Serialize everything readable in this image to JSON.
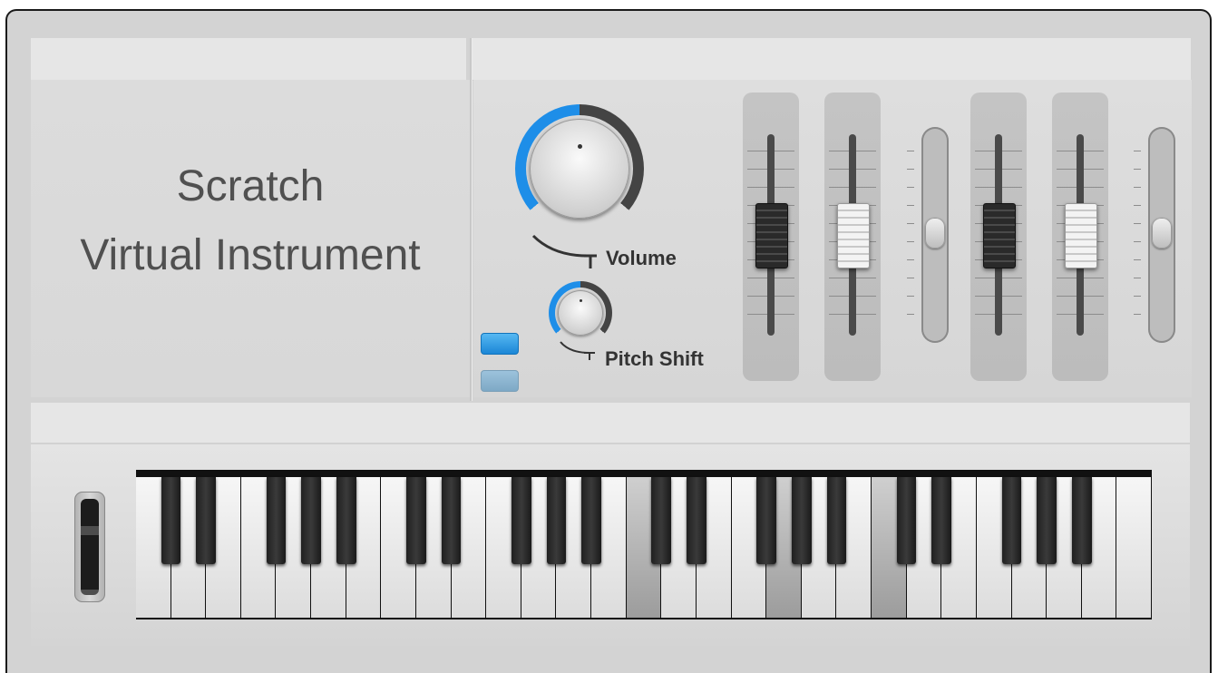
{
  "header": {
    "title_line1": "Scratch",
    "title_line2": "Virtual Instrument"
  },
  "controls": {
    "volume_label": "Volume",
    "pitch_shift_label": "Pitch Shift",
    "volume_level": 0.62,
    "pitch_shift_level": 0.5,
    "buttons": [
      {
        "name": "add-button",
        "state": "active"
      },
      {
        "name": "add-button-secondary",
        "state": "inactive"
      }
    ]
  },
  "faders": [
    {
      "style": "dark",
      "level": 0.5
    },
    {
      "style": "light",
      "level": 0.5
    },
    {
      "style": "slot",
      "level": 0.5
    },
    {
      "style": "dark",
      "level": 0.5
    },
    {
      "style": "light",
      "level": 0.5
    },
    {
      "style": "slot",
      "level": 0.5
    }
  ],
  "keyboard": {
    "white_key_count": 29,
    "pressed_white_keys": [
      14,
      18,
      21
    ]
  },
  "colors": {
    "accent": "#1e8ee8",
    "panel": "#d8d8d8",
    "text": "#505050"
  }
}
